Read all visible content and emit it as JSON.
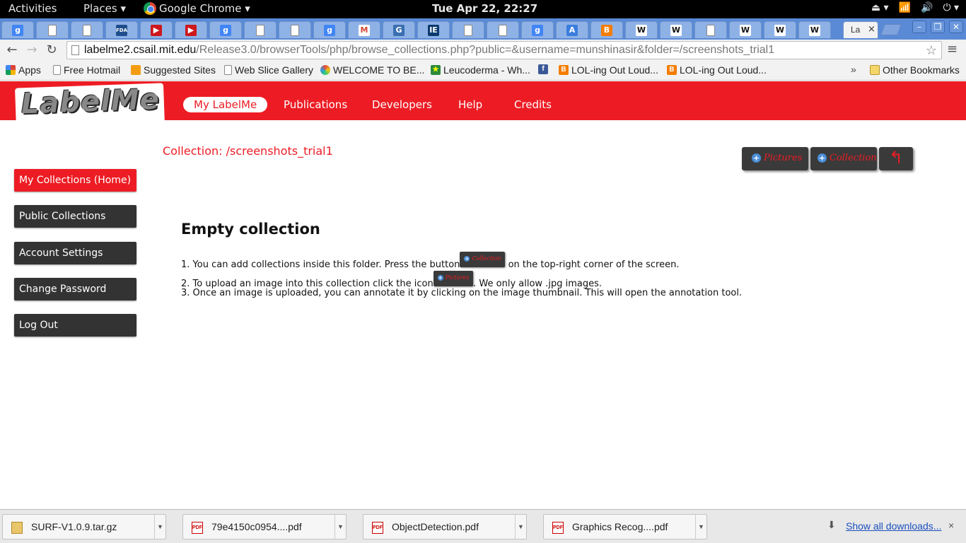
{
  "topbar": {
    "activities": "Activities",
    "places": "Places ▾",
    "app": "Google Chrome ▾",
    "clock": "Tue Apr 22, 22:27",
    "sys_icons": [
      "⏏ ▾",
      "wifi-icon",
      "volume-icon",
      "power-icon ▾"
    ]
  },
  "tabs": {
    "favicons": [
      "g",
      "doc",
      "doc",
      "FDA",
      "yt",
      "yt",
      "g",
      "doc",
      "doc",
      "g",
      "gmail",
      "sc",
      "IEEE",
      "doc",
      "doc",
      "g",
      "A",
      "blogger",
      "W",
      "W",
      "doc",
      "W",
      "W",
      "W"
    ],
    "active_title": "La",
    "active_close": "×"
  },
  "window_controls": {
    "minimize": "–",
    "maximize": "❐",
    "close": "✕"
  },
  "address": {
    "host": "labelme2.csail.mit.edu",
    "path": "/Release3.0/browserTools/php/browse_collections.php?public=&username=munshinasir&folder=/screenshots_trial1",
    "star": "☆",
    "back": "←",
    "forward": "→",
    "reload": "↻",
    "menu": "≡"
  },
  "bookmarks": {
    "items": [
      {
        "label": "Apps",
        "icon": "apps-grid"
      },
      {
        "label": "Free Hotmail",
        "icon": "doc"
      },
      {
        "label": "Suggested Sites",
        "icon": "bulb"
      },
      {
        "label": "Web Slice Gallery",
        "icon": "doc"
      },
      {
        "label": "WELCOME TO BE...",
        "icon": "color"
      },
      {
        "label": "Leucoderma - Wh...",
        "icon": "star"
      },
      {
        "label": "",
        "icon": "facebook"
      },
      {
        "label": "LOL-ing Out Loud...",
        "icon": "blogger"
      },
      {
        "label": "LOL-ing Out Loud...",
        "icon": "blogger"
      }
    ],
    "more": "»",
    "other": "Other Bookmarks"
  },
  "labelme": {
    "logo": "LabelMe",
    "nav": [
      "My LabelMe",
      "Publications",
      "Developers",
      "Help",
      "Credits"
    ]
  },
  "sidebar": {
    "items": [
      "My Collections (Home)",
      "Public Collections",
      "Account Settings",
      "Change Password",
      "Log Out"
    ]
  },
  "main": {
    "collection_title": "Collection: /screenshots_trial1",
    "btn_pictures": "Pictures",
    "btn_collection": "Collection",
    "btn_back": "↰",
    "empty_heading": "Empty collection",
    "line1_a": "1. You can add collections inside this folder. Press the button",
    "line1_b": "on the top-right corner of the screen.",
    "line2_a": "2. To upload an image into this collection click the icon",
    "line2_b": ". We only allow .jpg images.",
    "line3": "3. Once an image is uploaded, you can annotate it by clicking on the image thumbnail. This will open the annotation tool."
  },
  "downloads": {
    "items": [
      "SURF-V1.0.9.tar.gz",
      "79e4150c0954....pdf",
      "ObjectDetection.pdf",
      "Graphics Recog....pdf"
    ],
    "show_all": "Show all downloads...",
    "close": "×"
  }
}
